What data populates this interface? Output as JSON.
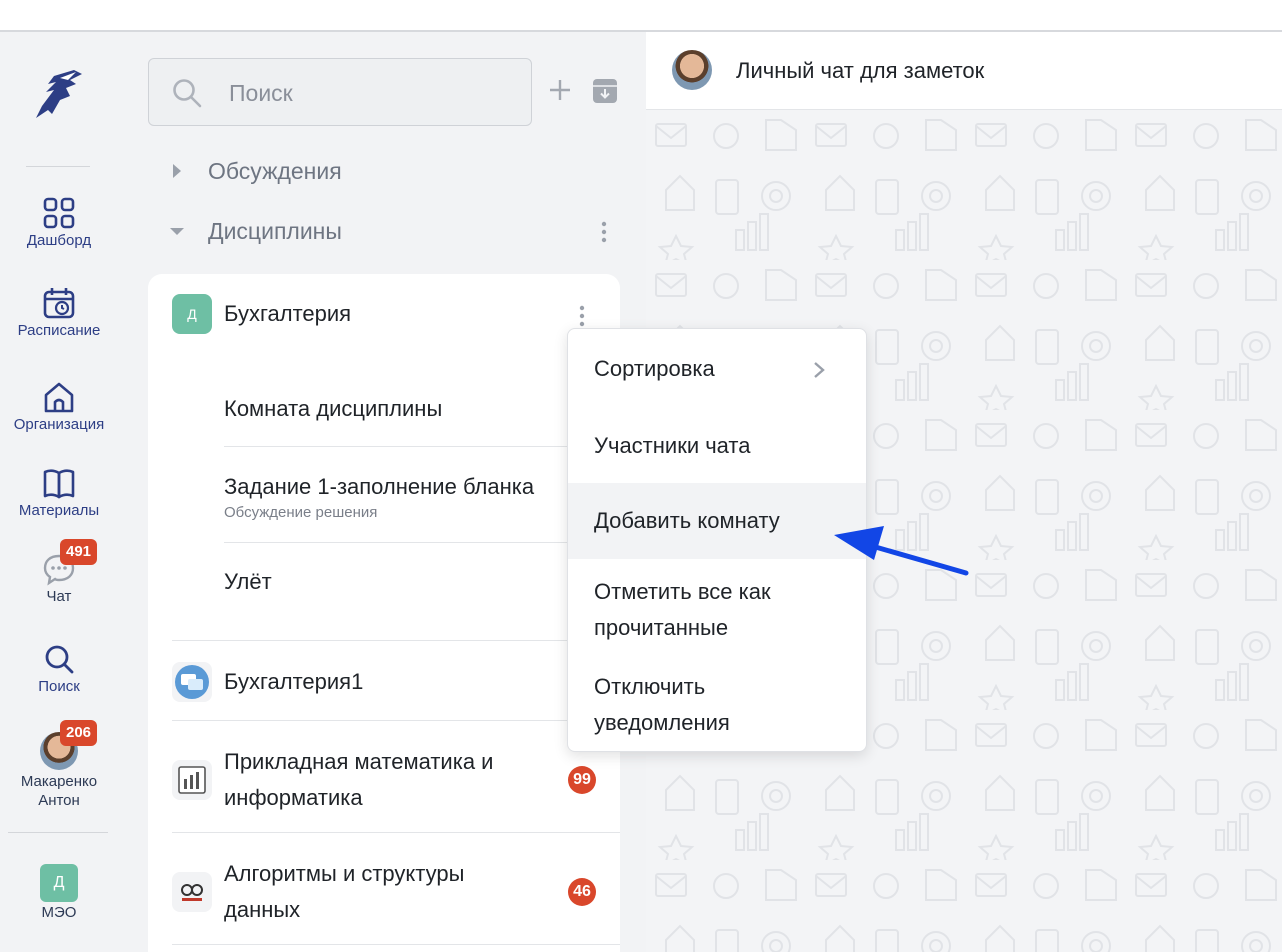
{
  "sidebar": {
    "items": [
      {
        "label": "Дашборд",
        "icon": "dashboard-icon"
      },
      {
        "label": "Расписание",
        "icon": "calendar-icon"
      },
      {
        "label": "Организация",
        "icon": "home-icon"
      },
      {
        "label": "Материалы",
        "icon": "book-icon"
      },
      {
        "label": "Чат",
        "icon": "chat-icon",
        "badge": "491"
      },
      {
        "label": "Поиск",
        "icon": "search-icon"
      }
    ],
    "user": {
      "name_line1": "Макаренко",
      "name_line2": "Антон",
      "badge": "206"
    },
    "org": {
      "letter": "Д",
      "label": "МЭО"
    }
  },
  "search": {
    "placeholder": "Поиск"
  },
  "groups": {
    "discussions": "Обсуждения",
    "disciplines": "Дисциплины"
  },
  "channels": [
    {
      "name": "Бухгалтерия",
      "letter": "Д",
      "color": "#6ebfa4",
      "rooms": [
        {
          "name": "Комната дисциплины",
          "sub": ""
        },
        {
          "name": "Задание 1-заполнение бланка",
          "sub": "Обсуждение решения"
        },
        {
          "name": "Улёт",
          "sub": ""
        }
      ]
    },
    {
      "name": "Бухгалтерия1"
    },
    {
      "name_line1": "Прикладная математика и",
      "name_line2": "информатика",
      "count": "99"
    },
    {
      "name_line1": "Алгоритмы и структуры",
      "name_line2": "данных",
      "count": "46"
    }
  ],
  "chat": {
    "title": "Личный чат для заметок"
  },
  "context_menu": {
    "items": [
      {
        "label": "Сортировка"
      },
      {
        "label": "Участники чата"
      },
      {
        "label": "Добавить комнату"
      },
      {
        "label_line1": "Отметить все как",
        "label_line2": "прочитанные"
      },
      {
        "label_line1": "Отключить",
        "label_line2": "уведомления"
      }
    ]
  },
  "colors": {
    "accent": "#2d3e85",
    "badge": "#d9472b",
    "arrow": "#1246e6"
  }
}
